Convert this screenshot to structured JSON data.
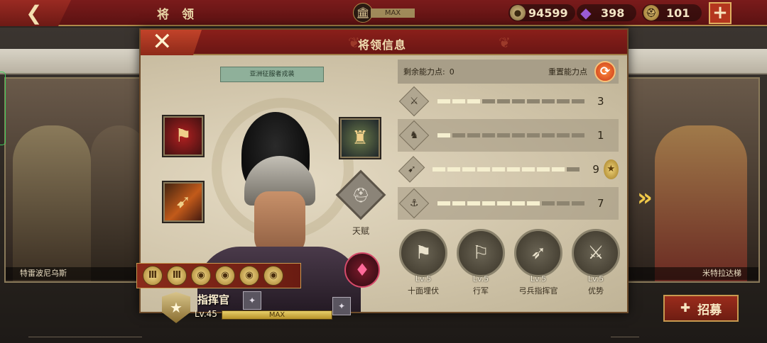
{
  "topbar": {
    "back_icon": "chevron-left-icon",
    "title": "将 领",
    "building_max": "MAX",
    "coins": "94599",
    "gems": "398",
    "helmets": "101",
    "plus": "+"
  },
  "background": {
    "left_general_name": "特雷波尼乌斯",
    "left_general_level": "Lv.",
    "right_general_name": "米特拉达梯",
    "recruit_label": "招募"
  },
  "modal": {
    "title": "将领信息",
    "close_label": "✕",
    "skin_label": "亚洲征服者戎装",
    "talent_label": "天赋",
    "rank_name": "指挥官",
    "level": "Lv.45",
    "level_max": "MAX",
    "skill_coins": [
      "Ⅲ",
      "Ⅲ",
      "◉",
      "◉",
      "◉",
      "◉"
    ],
    "attributes": {
      "remaining_label": "剩余能力点:",
      "remaining_value": "0",
      "reset_label": "重置能力点",
      "rows": [
        {
          "icon": "sword-icon",
          "glyph": "⚔",
          "filled": 3,
          "total": 10,
          "value": "3"
        },
        {
          "icon": "horse-icon",
          "glyph": "♞",
          "filled": 1,
          "total": 10,
          "value": "1"
        },
        {
          "icon": "bow-icon",
          "glyph": "➹",
          "filled": 9,
          "total": 10,
          "value": "9",
          "bonus": "★"
        },
        {
          "icon": "anchor-icon",
          "glyph": "⚓",
          "filled": 7,
          "total": 10,
          "value": "7"
        }
      ]
    },
    "abilities": [
      {
        "lv": "Lv.5",
        "name": "十面埋伏",
        "glyph": "⚑"
      },
      {
        "lv": "Lv.5",
        "name": "行军",
        "glyph": "⚐"
      },
      {
        "lv": "Lv.5",
        "name": "弓兵指挥官",
        "glyph": "➶"
      },
      {
        "lv": "Lv.5",
        "name": "优势",
        "glyph": "⚔"
      }
    ]
  },
  "colors": {
    "header_red": "#7a1b1b",
    "gold": "#c89a50",
    "panel_bg": "#d6cbb1"
  }
}
